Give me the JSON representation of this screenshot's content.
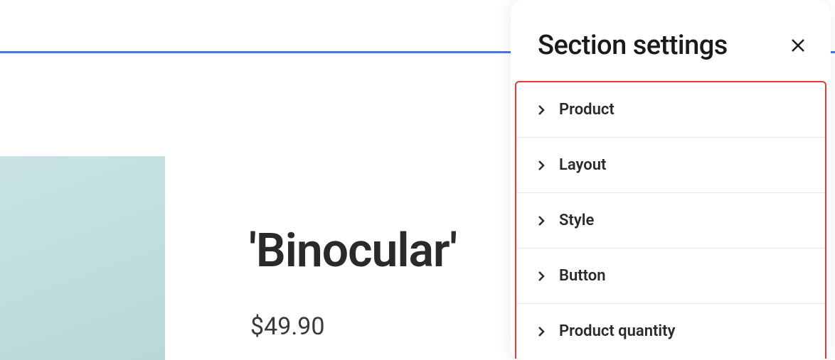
{
  "product": {
    "title": "'Binocular'",
    "price": "$49.90"
  },
  "panel": {
    "title": "Section settings",
    "items": [
      {
        "label": "Product"
      },
      {
        "label": "Layout"
      },
      {
        "label": "Style"
      },
      {
        "label": "Button"
      },
      {
        "label": "Product quantity"
      }
    ]
  }
}
